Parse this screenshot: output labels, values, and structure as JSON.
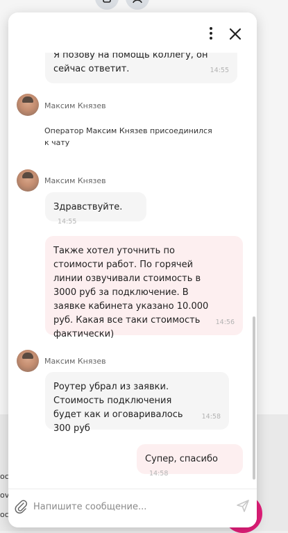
{
  "chat": {
    "messages": [
      {
        "type": "in",
        "text": "Я позову на помощь коллегу, он сейчас ответит.",
        "time": "14:55"
      },
      {
        "type": "author",
        "name": "Максим Князев"
      },
      {
        "type": "system",
        "text": "Оператор Максим Князев присоединился к чату"
      },
      {
        "type": "author",
        "name": "Максим Князев"
      },
      {
        "type": "in",
        "text": "Здравствуйте.",
        "time": "14:55"
      },
      {
        "type": "out",
        "text": "Также хотел уточнить по стоимости работ. По горячей линии озвучивали стоимость в 3000 руб за подключение. В заявке кабинета указано 10.000 руб. Какая все таки стоимость фактически)",
        "time": "14:56"
      },
      {
        "type": "author",
        "name": "Максим Князев"
      },
      {
        "type": "in",
        "text": "Роутер убрал из заявки. Стоимость подключения будет как и оговаривалось 300 руб",
        "time": "14:58"
      },
      {
        "type": "out",
        "text": "Супер, спасибо",
        "time": "14:58"
      }
    ]
  },
  "composer": {
    "placeholder": "Напишите сообщение..."
  },
  "background": {
    "fragments": [
      "ос",
      "ov",
      "ос"
    ]
  },
  "icons": {
    "menu": "more-vertical-icon",
    "close": "close-icon",
    "attach": "paperclip-icon",
    "send": "send-icon"
  },
  "colors": {
    "incoming_bubble": "#f5f5f5",
    "outgoing_bubble": "#fdeff0",
    "accent": "#e31e7a"
  }
}
